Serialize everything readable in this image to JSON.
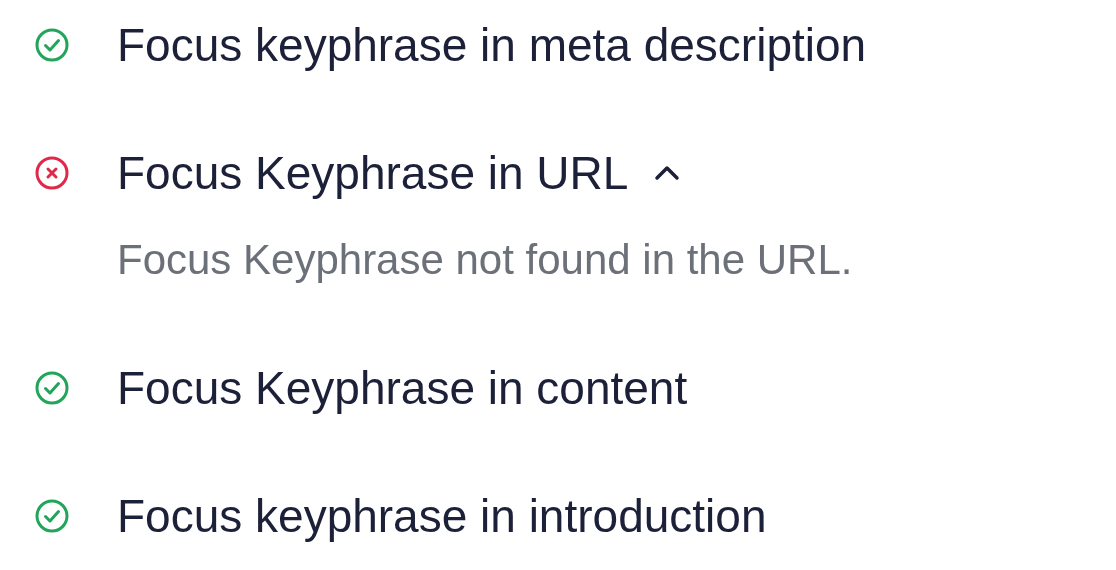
{
  "checks": [
    {
      "title": "Focus keyphrase in meta description",
      "kind": "pass"
    },
    {
      "title": "Focus Keyphrase in URL",
      "kind": "fail",
      "expanded": true,
      "detail": "Focus Keyphrase not found in the URL."
    },
    {
      "title": "Focus Keyphrase in content",
      "kind": "pass"
    },
    {
      "title": "Focus keyphrase in introduction",
      "kind": "pass"
    }
  ]
}
